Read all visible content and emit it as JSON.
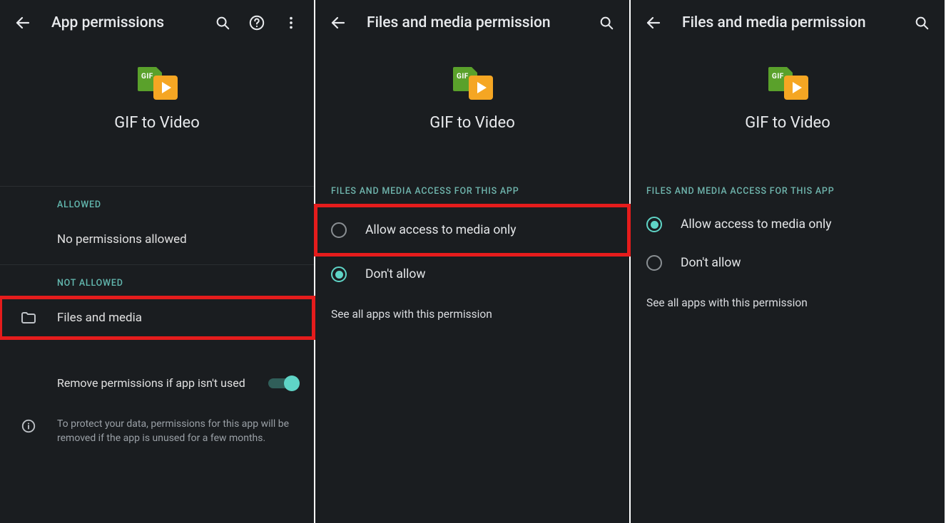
{
  "panel1": {
    "title": "App permissions",
    "app_name": "GIF to Video",
    "gif_badge": "GIF",
    "allowed_label": "ALLOWED",
    "no_permissions": "No permissions allowed",
    "not_allowed_label": "NOT ALLOWED",
    "files_media": "Files and media",
    "remove_perms": "Remove permissions if app isn't used",
    "note": "To protect your data, permissions for this app will be removed if the app is unused for a few months."
  },
  "panel2": {
    "title": "Files and media permission",
    "app_name": "GIF to Video",
    "gif_badge": "GIF",
    "section": "FILES AND MEDIA ACCESS FOR THIS APP",
    "opt_allow": "Allow access to media only",
    "opt_deny": "Don't allow",
    "see_all": "See all apps with this permission"
  },
  "panel3": {
    "title": "Files and media permission",
    "app_name": "GIF to Video",
    "gif_badge": "GIF",
    "section": "FILES AND MEDIA ACCESS FOR THIS APP",
    "opt_allow": "Allow access to media only",
    "opt_deny": "Don't allow",
    "see_all": "See all apps with this permission"
  }
}
